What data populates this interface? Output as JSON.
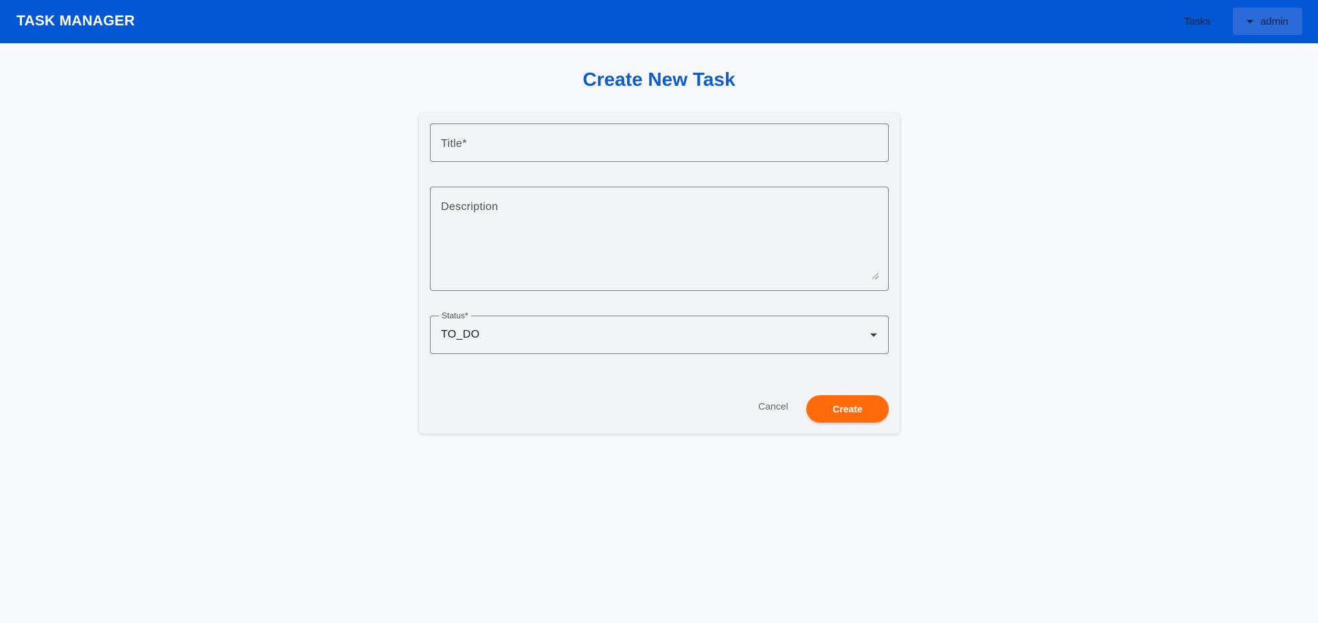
{
  "app": {
    "brand": "TASK MANAGER",
    "colors": {
      "appbar": "#0257d4",
      "accent": "#ff6a0a",
      "title": "#0f5bc9"
    }
  },
  "nav": {
    "tasks_label": "Tasks",
    "user_label": "admin",
    "user_icon": "chevron-down-icon"
  },
  "page": {
    "title": "Create New Task"
  },
  "form": {
    "title_placeholder": "Title*",
    "description_placeholder": "Description",
    "status_label": "Status*",
    "status_value": "TO_DO",
    "cancel_label": "Cancel",
    "create_label": "Create"
  }
}
